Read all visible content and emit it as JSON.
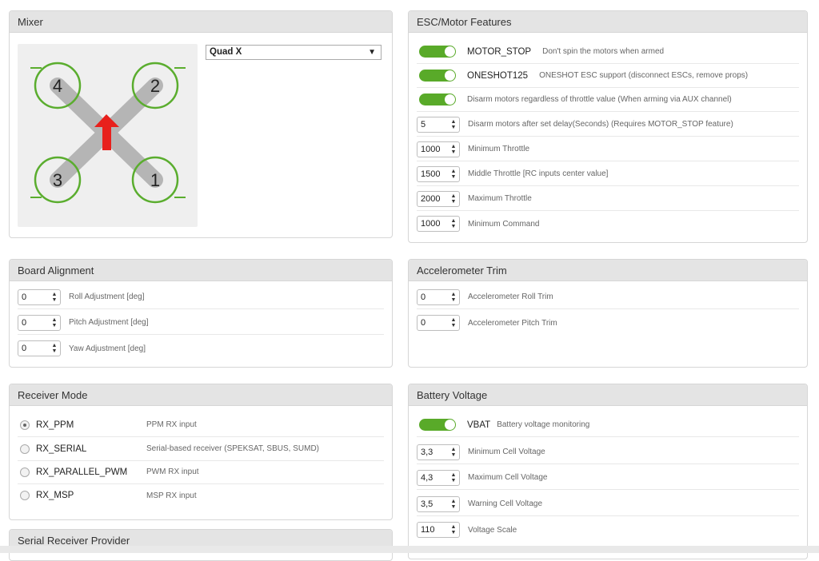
{
  "mixer": {
    "title": "Mixer",
    "selected": "Quad X",
    "motors": [
      "1",
      "2",
      "3",
      "4"
    ]
  },
  "esc": {
    "title": "ESC/Motor Features",
    "features": [
      {
        "name": "MOTOR_STOP",
        "desc": "Don't spin the motors when armed",
        "enabled": true
      },
      {
        "name": "ONESHOT125",
        "desc": "ONESHOT ESC support (disconnect ESCs, remove props)",
        "enabled": true
      },
      {
        "name": "",
        "desc": "Disarm motors regardless of throttle value (When arming via AUX channel)",
        "enabled": true
      }
    ],
    "fields": [
      {
        "value": "5",
        "label": "Disarm motors after set delay(Seconds) (Requires MOTOR_STOP feature)"
      },
      {
        "value": "1000",
        "label": "Minimum Throttle"
      },
      {
        "value": "1500",
        "label": "Middle Throttle [RC inputs center value]"
      },
      {
        "value": "2000",
        "label": "Maximum Throttle"
      },
      {
        "value": "1000",
        "label": "Minimum Command"
      }
    ]
  },
  "board": {
    "title": "Board Alignment",
    "fields": [
      {
        "value": "0",
        "label": "Roll Adjustment [deg]"
      },
      {
        "value": "0",
        "label": "Pitch Adjustment [deg]"
      },
      {
        "value": "0",
        "label": "Yaw Adjustment [deg]"
      }
    ]
  },
  "acc": {
    "title": "Accelerometer Trim",
    "fields": [
      {
        "value": "0",
        "label": "Accelerometer Roll Trim"
      },
      {
        "value": "0",
        "label": "Accelerometer Pitch Trim"
      }
    ]
  },
  "receiver": {
    "title": "Receiver Mode",
    "modes": [
      {
        "name": "RX_PPM",
        "desc": "PPM RX input",
        "selected": true
      },
      {
        "name": "RX_SERIAL",
        "desc": "Serial-based receiver (SPEKSAT, SBUS, SUMD)",
        "selected": false
      },
      {
        "name": "RX_PARALLEL_PWM",
        "desc": "PWM RX input",
        "selected": false
      },
      {
        "name": "RX_MSP",
        "desc": "MSP RX input",
        "selected": false
      }
    ]
  },
  "serial_provider": {
    "title": "Serial Receiver Provider"
  },
  "battery": {
    "title": "Battery Voltage",
    "vbat": {
      "name": "VBAT",
      "desc": "Battery voltage monitoring",
      "enabled": true
    },
    "fields": [
      {
        "value": "3,3",
        "label": "Minimum Cell Voltage"
      },
      {
        "value": "4,3",
        "label": "Maximum Cell Voltage"
      },
      {
        "value": "3,5",
        "label": "Warning Cell Voltage"
      },
      {
        "value": "110",
        "label": "Voltage Scale"
      }
    ]
  },
  "colors": {
    "toggle_on": "#59aa29",
    "motor_ring": "#5aad2e",
    "arrow": "#e8201c"
  }
}
